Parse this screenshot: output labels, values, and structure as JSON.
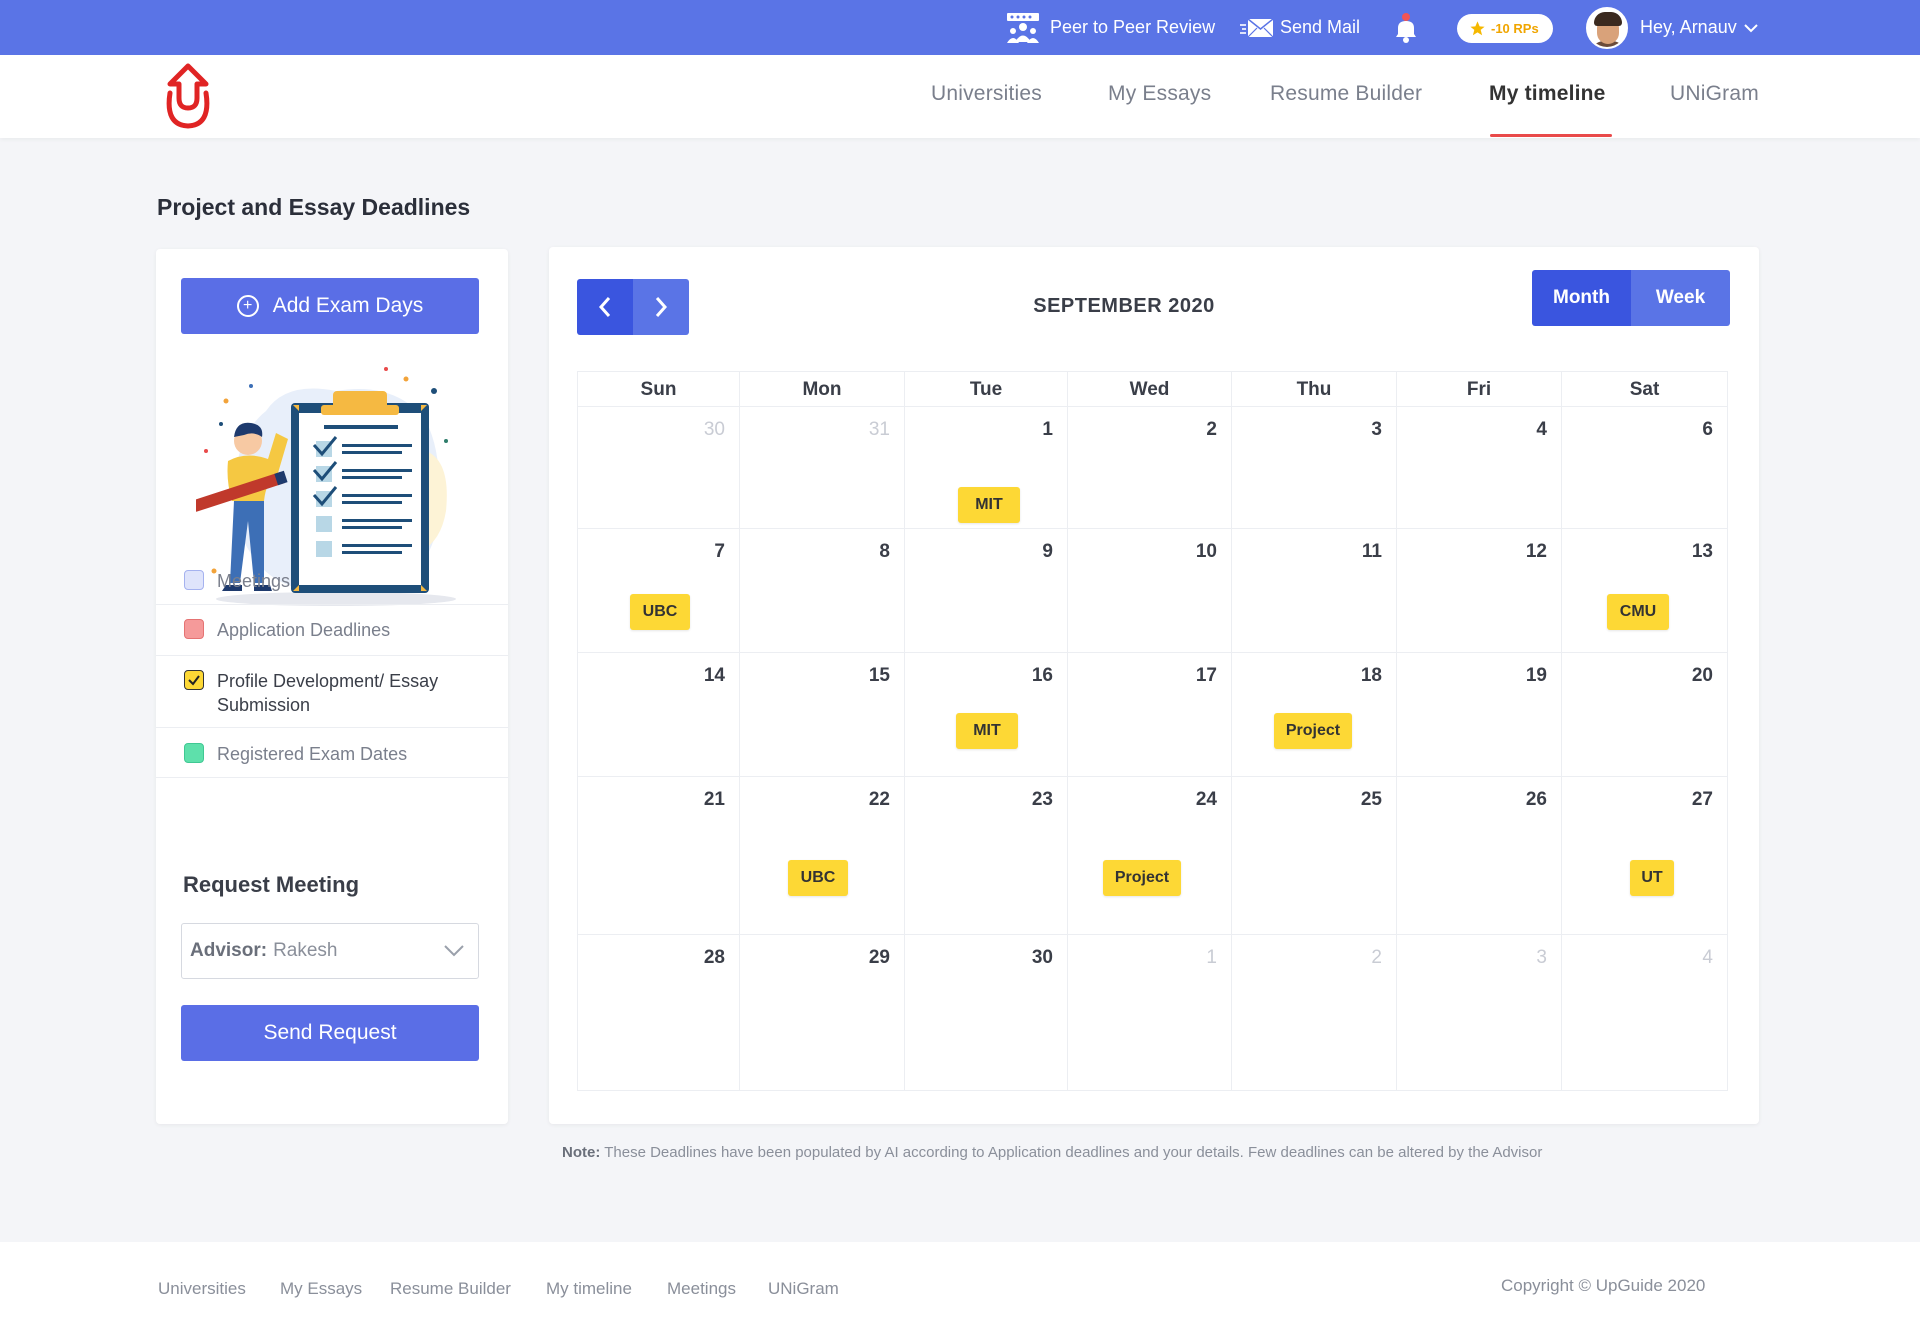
{
  "topbar": {
    "peer_review": "Peer to Peer Review",
    "send_mail": "Send Mail",
    "rp_badge": "-10 RPs",
    "greeting": "Hey, Arnauv"
  },
  "nav": {
    "items": [
      "Universities",
      "My Essays",
      "Resume Builder",
      "My timeline",
      "UNiGram"
    ],
    "active": "My timeline"
  },
  "page_title": "Project and Essay Deadlines",
  "sidebar": {
    "add_exam_days": "Add Exam Days",
    "legend": [
      {
        "label": "Meetings",
        "color": "#dfe4fb",
        "border": "#a5b2ef",
        "checked": false
      },
      {
        "label": "Application Deadlines",
        "color": "#f59a9a",
        "border": "#e57373",
        "checked": false
      },
      {
        "label": "Profile Development/ Essay Submission",
        "color": "#fdd835",
        "border": "#333333",
        "checked": true
      },
      {
        "label": "Registered Exam Dates",
        "color": "#5ee0ab",
        "border": "#40c893",
        "checked": false
      }
    ],
    "request_meeting_title": "Request Meeting",
    "advisor_label": "Advisor:",
    "advisor_value": "Rakesh",
    "send_request": "Send Request"
  },
  "calendar": {
    "title": "SEPTEMBER 2020",
    "view_month": "Month",
    "view_week": "Week",
    "days_of_week": [
      "Sun",
      "Mon",
      "Tue",
      "Wed",
      "Thu",
      "Fri",
      "Sat"
    ],
    "weeks": [
      [
        {
          "d": "30",
          "m": true
        },
        {
          "d": "31",
          "m": true
        },
        {
          "d": "1",
          "e": "MIT"
        },
        {
          "d": "2"
        },
        {
          "d": "3"
        },
        {
          "d": "4"
        },
        {
          "d": "6"
        }
      ],
      [
        {
          "d": "7",
          "e": "UBC"
        },
        {
          "d": "8"
        },
        {
          "d": "9"
        },
        {
          "d": "10"
        },
        {
          "d": "11"
        },
        {
          "d": "12"
        },
        {
          "d": "13",
          "e": "CMU"
        }
      ],
      [
        {
          "d": "14"
        },
        {
          "d": "15"
        },
        {
          "d": "16",
          "e": "MIT"
        },
        {
          "d": "17"
        },
        {
          "d": "18",
          "e": "Project"
        },
        {
          "d": "19"
        },
        {
          "d": "20"
        }
      ],
      [
        {
          "d": "21"
        },
        {
          "d": "22",
          "e": "UBC"
        },
        {
          "d": "23"
        },
        {
          "d": "24",
          "e": "Project"
        },
        {
          "d": "25"
        },
        {
          "d": "26"
        },
        {
          "d": "27",
          "e": "UT"
        }
      ],
      [
        {
          "d": "28"
        },
        {
          "d": "29"
        },
        {
          "d": "30"
        },
        {
          "d": "1",
          "m": true
        },
        {
          "d": "2",
          "m": true
        },
        {
          "d": "3",
          "m": true
        },
        {
          "d": "4",
          "m": true
        }
      ]
    ]
  },
  "note_label": "Note:",
  "note_text": "These Deadlines have been populated by AI according to Application deadlines and your details. Few deadlines can be altered by the Advisor",
  "footer": {
    "links": [
      "Universities",
      "My Essays",
      "Resume Builder",
      "My timeline",
      "Meetings",
      "UNiGram"
    ],
    "copyright": "Copyright © UpGuide 2020"
  }
}
